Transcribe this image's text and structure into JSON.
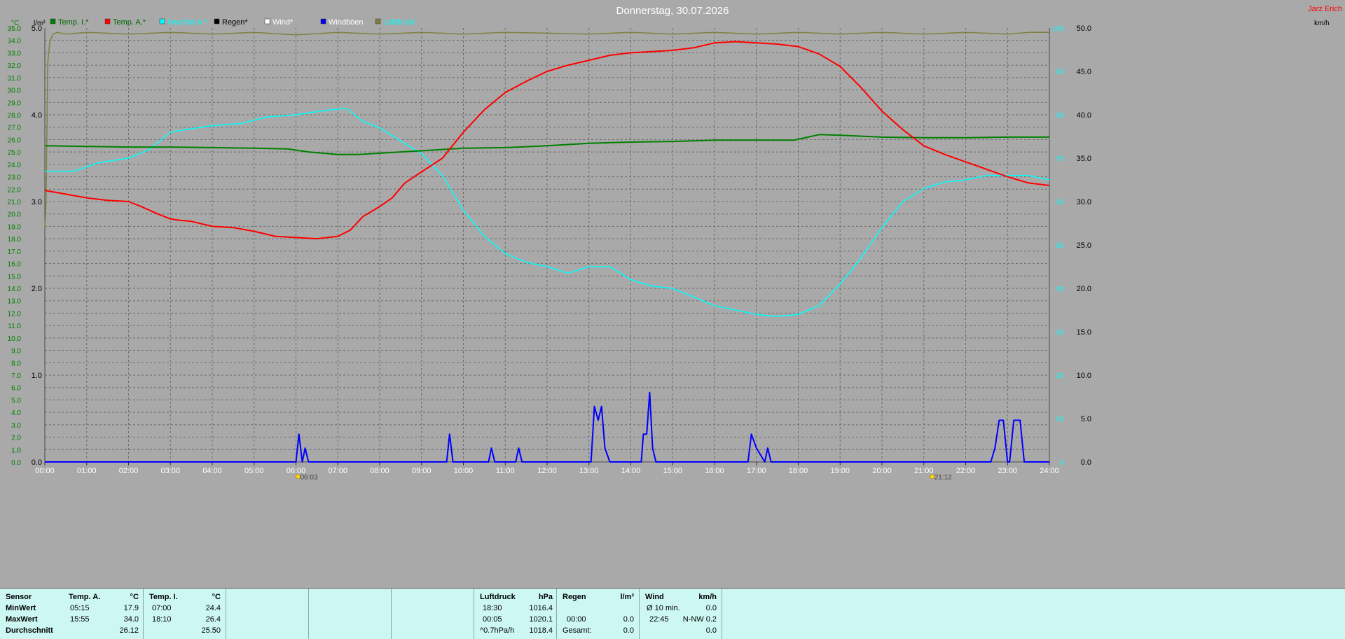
{
  "chart_title": "Donnerstag, 30.07.2026",
  "author": "Jarz Erich",
  "units": {
    "temp": "°C",
    "rain": "l/m²",
    "pressure": "hPa",
    "wind": "km/h"
  },
  "legend": [
    {
      "label": "Temp. I.*",
      "color": "#008000",
      "text_color": "#006400"
    },
    {
      "label": "Temp. A.*",
      "color": "#ff0000",
      "text_color": "#006400"
    },
    {
      "label": "Feuchte A.*",
      "color": "#00ffff",
      "text_color": "#00ffff"
    },
    {
      "label": "Regen*",
      "color": "#000000",
      "text_color": "#000000"
    },
    {
      "label": "Wind*",
      "color": "#ffffff",
      "text_color": "#ffffff"
    },
    {
      "label": "Windböen",
      "color": "#0000ff",
      "text_color": "#ffffff"
    },
    {
      "label": "Luftdruck",
      "color": "#808040",
      "text_color": "#00ffff"
    }
  ],
  "sun_markers": [
    {
      "time": "06:03",
      "hour": 6.05
    },
    {
      "time": "21:12",
      "hour": 21.2
    }
  ],
  "chart_data": {
    "type": "line",
    "xlabel": "",
    "x_ticks": [
      "00:00",
      "01:00",
      "02:00",
      "03:00",
      "04:00",
      "05:00",
      "06:00",
      "07:00",
      "08:00",
      "09:00",
      "10:00",
      "11:00",
      "12:00",
      "13:00",
      "14:00",
      "15:00",
      "16:00",
      "17:00",
      "18:00",
      "19:00",
      "20:00",
      "21:00",
      "22:00",
      "23:00",
      "24:00"
    ],
    "xlim": [
      0,
      24
    ],
    "axes": {
      "temp": {
        "label": "°C",
        "ylim": [
          0,
          35
        ],
        "ticks": [
          "0.0",
          "1.0",
          "2.0",
          "3.0",
          "4.0",
          "5.0",
          "6.0",
          "7.0",
          "8.0",
          "9.0",
          "10.0",
          "11.0",
          "12.0",
          "13.0",
          "14.0",
          "15.0",
          "16.0",
          "17.0",
          "18.0",
          "19.0",
          "20.0",
          "21.0",
          "22.0",
          "23.0",
          "24.0",
          "25.0",
          "26.0",
          "27.0",
          "28.0",
          "29.0",
          "30.0",
          "31.0",
          "32.0",
          "33.0",
          "34.0",
          "35.0"
        ]
      },
      "rain": {
        "label": "l/m²",
        "ylim": [
          0,
          5
        ],
        "ticks": [
          "0.0",
          "1.0",
          "2.0",
          "3.0",
          "4.0",
          "5.0"
        ]
      },
      "humidity": {
        "label": "%",
        "ylim": [
          0,
          100
        ],
        "ticks": [
          "0",
          "10",
          "20",
          "30",
          "40",
          "50",
          "60",
          "70",
          "80",
          "90",
          "100"
        ]
      },
      "wind": {
        "label": "km/h",
        "ylim": [
          0,
          50
        ],
        "ticks": [
          "0.0",
          "5.0",
          "10.0",
          "15.0",
          "20.0",
          "25.0",
          "30.0",
          "35.0",
          "40.0",
          "45.0",
          "50.0"
        ]
      }
    },
    "series": [
      {
        "name": "Temp. I.*",
        "axis": "temp",
        "color": "#008000",
        "x": [
          0,
          1,
          2,
          3,
          4,
          5,
          5.8,
          6.3,
          7,
          7.5,
          8,
          9,
          10,
          11,
          12,
          13,
          14,
          15,
          16,
          17,
          17.9,
          18.5,
          19,
          20,
          21,
          22,
          23,
          24
        ],
        "y": [
          25.5,
          25.45,
          25.4,
          25.4,
          25.35,
          25.3,
          25.25,
          25.0,
          24.8,
          24.8,
          24.9,
          25.1,
          25.3,
          25.35,
          25.5,
          25.7,
          25.8,
          25.85,
          25.95,
          25.95,
          25.95,
          26.4,
          26.35,
          26.2,
          26.15,
          26.15,
          26.2,
          26.2
        ]
      },
      {
        "name": "Temp. A.*",
        "axis": "temp",
        "color": "#ff0000",
        "x": [
          0,
          0.5,
          1,
          1.5,
          2,
          2.3,
          2.7,
          3,
          3.2,
          3.5,
          4,
          4.5,
          5,
          5.5,
          6,
          6.5,
          7,
          7.3,
          7.6,
          8,
          8.3,
          8.6,
          9,
          9.5,
          10,
          10.5,
          11,
          11.5,
          12,
          12.5,
          13,
          13.5,
          14,
          14.5,
          15,
          15.5,
          16,
          16.5,
          17,
          17.5,
          18,
          18.5,
          19,
          19.5,
          20,
          20.5,
          21,
          21.5,
          22,
          22.5,
          23,
          23.5,
          24
        ],
        "y": [
          21.9,
          21.6,
          21.3,
          21.1,
          21.0,
          20.6,
          20.0,
          19.6,
          19.5,
          19.4,
          19.0,
          18.9,
          18.6,
          18.2,
          18.1,
          18.0,
          18.2,
          18.7,
          19.8,
          20.6,
          21.3,
          22.5,
          23.4,
          24.5,
          26.6,
          28.4,
          29.8,
          30.7,
          31.5,
          32.0,
          32.4,
          32.8,
          33.0,
          33.1,
          33.2,
          33.4,
          33.8,
          33.9,
          33.8,
          33.7,
          33.5,
          32.9,
          31.9,
          30.2,
          28.3,
          26.8,
          25.5,
          24.8,
          24.2,
          23.6,
          23.0,
          22.5,
          22.3
        ]
      },
      {
        "name": "Feuchte A.*",
        "axis": "humidity",
        "color": "#00ffff",
        "x": [
          0,
          0.7,
          1.3,
          2,
          2.5,
          3,
          3.3,
          4,
          4.7,
          5.3,
          6,
          6.7,
          7.2,
          7.6,
          8,
          8.5,
          9,
          9.5,
          10,
          10.5,
          11,
          11.5,
          12,
          12.5,
          13,
          13.5,
          14,
          14.5,
          15,
          15.5,
          16,
          16.5,
          17,
          17.5,
          18,
          18.5,
          19,
          19.5,
          20,
          20.5,
          21,
          21.5,
          22,
          22.5,
          23,
          23.5,
          24
        ],
        "y": [
          67,
          67,
          69,
          70,
          72,
          76,
          76.5,
          77.5,
          78,
          79.5,
          80,
          81,
          81.5,
          78.5,
          77,
          74,
          71,
          66,
          58,
          52,
          48,
          46,
          45,
          43.5,
          45,
          45,
          42,
          40.5,
          40,
          38,
          36,
          35,
          34,
          33.5,
          34,
          36,
          41,
          47,
          54,
          60,
          63,
          64.5,
          65,
          66,
          66,
          66,
          65
        ]
      },
      {
        "name": "Windböen",
        "axis": "wind",
        "color": "#0000ff",
        "x": [
          0,
          6.0,
          6.07,
          6.15,
          6.22,
          6.3,
          9.6,
          9.67,
          9.75,
          10.6,
          10.67,
          10.75,
          11.25,
          11.32,
          11.4,
          13.05,
          13.13,
          13.22,
          13.3,
          13.38,
          13.5,
          14.25,
          14.3,
          14.38,
          14.45,
          14.52,
          14.6,
          16.8,
          16.88,
          17.0,
          17.2,
          17.27,
          17.35,
          22.6,
          22.7,
          22.8,
          22.9,
          23.0,
          23.05,
          23.15,
          23.3,
          23.4,
          24
        ],
        "y": [
          0,
          0,
          3.2,
          0,
          1.6,
          0,
          0,
          3.2,
          0,
          0,
          1.6,
          0,
          0,
          1.6,
          0,
          0,
          6.4,
          4.8,
          6.4,
          1.6,
          0,
          0,
          3.2,
          3.2,
          8.0,
          1.6,
          0,
          0,
          3.2,
          1.6,
          0,
          1.6,
          0,
          0,
          1.6,
          4.8,
          4.8,
          0,
          0,
          4.8,
          4.8,
          0,
          0
        ]
      },
      {
        "name": "Luftdruck",
        "axis": "rain",
        "color": "#808040",
        "y_axis_min": 4.0,
        "x": [
          0,
          0.03,
          0.07,
          0.12,
          0.2,
          0.3,
          0.5,
          1,
          2,
          3,
          4,
          5,
          6,
          7,
          8,
          9,
          10,
          11,
          12,
          13,
          14,
          15,
          16,
          17,
          18,
          19,
          20,
          21,
          22,
          23,
          23.5,
          24
        ],
        "y": [
          2.7,
          3.0,
          4.6,
          4.85,
          4.93,
          4.95,
          4.93,
          4.95,
          4.93,
          4.95,
          4.93,
          4.95,
          4.92,
          4.95,
          4.93,
          4.95,
          4.93,
          4.95,
          4.94,
          4.93,
          4.95,
          4.93,
          4.95,
          4.93,
          4.95,
          4.93,
          4.95,
          4.93,
          4.95,
          4.93,
          4.95,
          4.95
        ]
      }
    ]
  },
  "stats": {
    "sensor_header": "Sensor",
    "row_labels": [
      "MinWert",
      "MaxWert",
      "Durchschnitt"
    ],
    "temp_a": {
      "header": "Temp. A.",
      "unit": "°C",
      "min_time": "05:15",
      "min": "17.9",
      "max_time": "15:55",
      "max": "34.0",
      "avg": "26.12"
    },
    "temp_i": {
      "header": "Temp. I.",
      "unit": "°C",
      "min_time": "07:00",
      "min": "24.4",
      "max_time": "18:10",
      "max": "26.4",
      "avg": "25.50"
    },
    "pressure": {
      "header": "Luftdruck",
      "unit": "hPa",
      "min_time": "18:30",
      "min": "1016.4",
      "max_time": "00:05",
      "max": "1020.1",
      "trend": "^0.7hPa/h",
      "avg": "1018.4"
    },
    "rain": {
      "header": "Regen",
      "unit": "l/m²",
      "max_time": "00:00",
      "max": "0.0",
      "total_label": "Gesamt:",
      "total": "0.0"
    },
    "wind": {
      "header": "Wind",
      "unit": "km/h",
      "avg_label": "Ø 10 min.",
      "avg": "0.0",
      "max_time": "22:45",
      "max": "N-NW 0.2",
      "mean": "0.0"
    }
  }
}
